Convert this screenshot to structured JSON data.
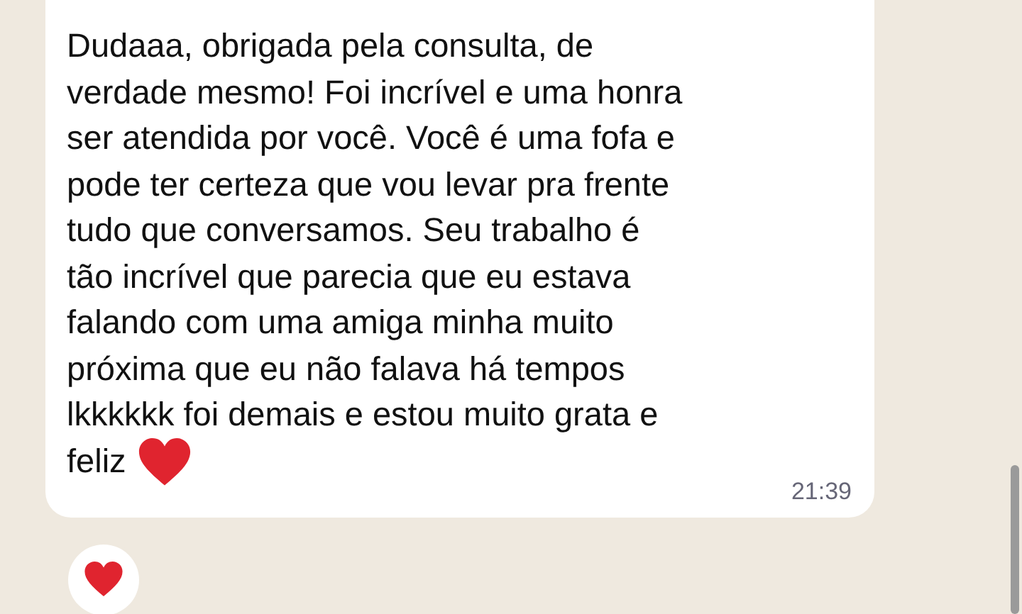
{
  "message": {
    "lines": [
      "Dudaaa, obrigada pela consulta, de",
      "verdade mesmo! Foi incrível e uma honra",
      "ser atendida por você. Você é uma fofa e",
      "pode ter certeza que vou levar pra frente",
      "tudo que conversamos. Seu trabalho é",
      "tão incrível que parecia que eu estava",
      "falando com uma amiga minha muito",
      "próxima que eu não falava há tempos",
      "lkkkkkk foi demais e estou muito grata e",
      "feliz"
    ],
    "time": "21:39"
  }
}
